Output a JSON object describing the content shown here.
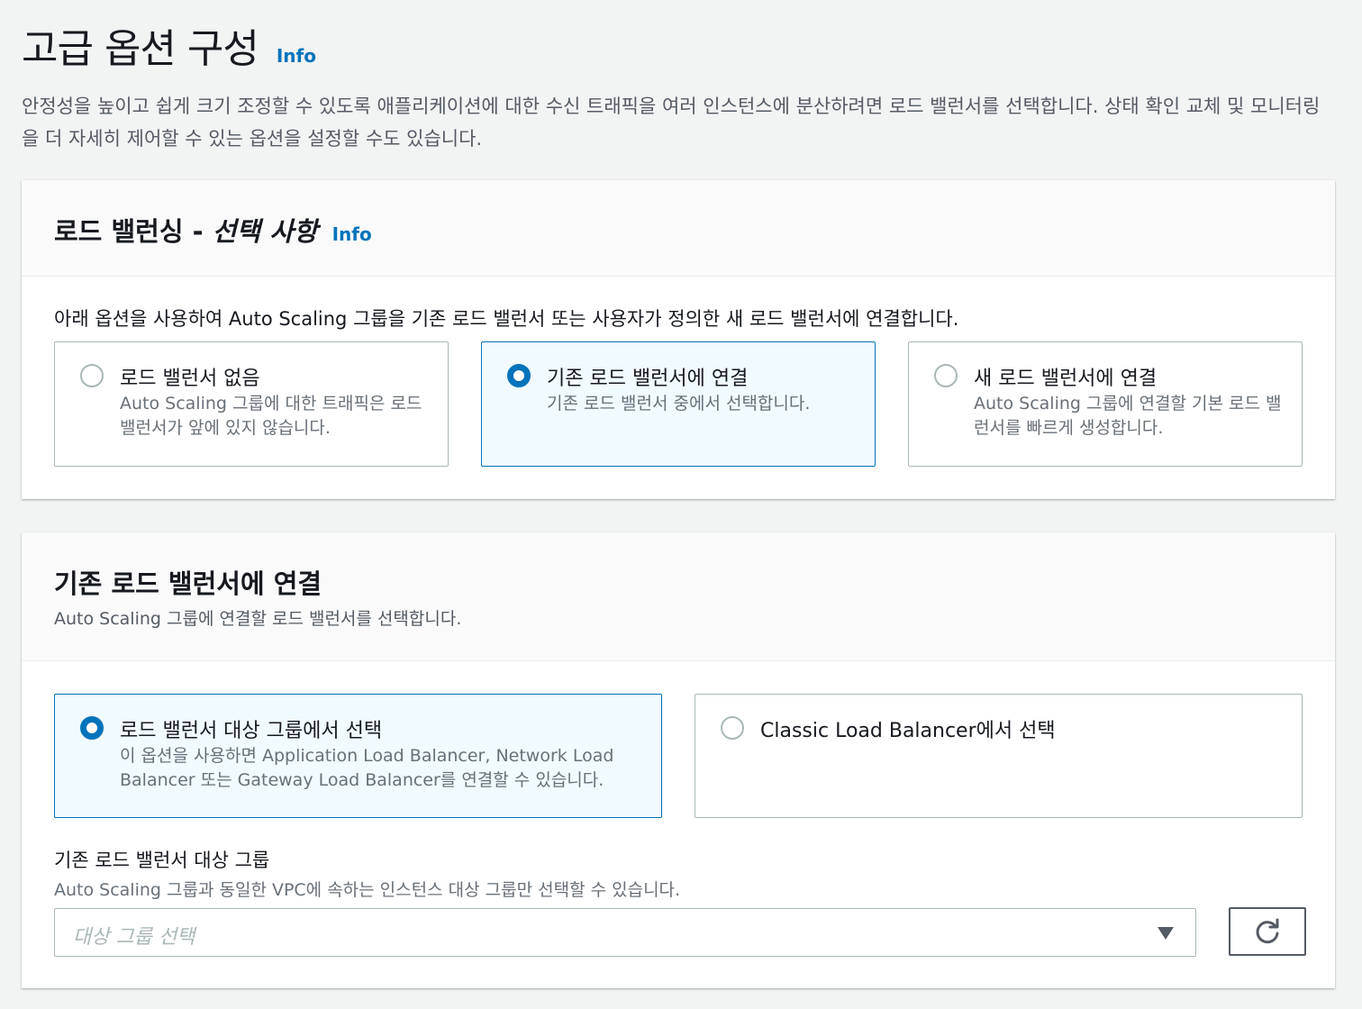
{
  "header": {
    "title": "고급 옵션 구성",
    "info": "Info",
    "description": "안정성을 높이고 쉽게 크기 조정할 수 있도록 애플리케이션에 대한 수신 트래픽을 여러 인스턴스에 분산하려면 로드 밸런서를 선택합니다. 상태 확인 교체 및 모니터링을 더 자세히 제어할 수 있는 옵션을 설정할 수도 있습니다."
  },
  "load_balancing": {
    "title_main": "로드 밸런싱 - ",
    "title_optional": "선택 사항",
    "info": "Info",
    "lead": "아래 옵션을 사용하여 Auto Scaling 그룹을 기존 로드 밸런서 또는 사용자가 정의한 새 로드 밸런서에 연결합니다.",
    "options": [
      {
        "label": "로드 밸런서 없음",
        "description": "Auto Scaling 그룹에 대한 트래픽은 로드 밸런서가 앞에 있지 않습니다.",
        "selected": false
      },
      {
        "label": "기존 로드 밸런서에 연결",
        "description": "기존 로드 밸런서 중에서 선택합니다.",
        "selected": true
      },
      {
        "label": "새 로드 밸런서에 연결",
        "description": "Auto Scaling 그룹에 연결할 기본 로드 밸런서를 빠르게 생성합니다.",
        "selected": false
      }
    ]
  },
  "existing_lb": {
    "title": "기존 로드 밸런서에 연결",
    "subtitle": "Auto Scaling 그룹에 연결할 로드 밸런서를 선택합니다.",
    "options": [
      {
        "label": "로드 밸런서 대상 그룹에서 선택",
        "description": "이 옵션을 사용하면 Application Load Balancer, Network Load Balancer 또는 Gateway Load Balancer를 연결할 수 있습니다.",
        "selected": true
      },
      {
        "label": "Classic Load Balancer에서 선택",
        "description": "",
        "selected": false
      }
    ],
    "target_group": {
      "label": "기존 로드 밸런서 대상 그룹",
      "description": "Auto Scaling 그룹과 동일한 VPC에 속하는 인스턴스 대상 그룹만 선택할 수 있습니다.",
      "placeholder": "대상 그룹 선택"
    }
  },
  "colors": {
    "accent": "#0073bb",
    "selected_tile_bg": "#f1faff",
    "background": "#f2f3f3"
  },
  "icons": {
    "caret": "caret-down-icon",
    "refresh": "refresh-icon"
  }
}
